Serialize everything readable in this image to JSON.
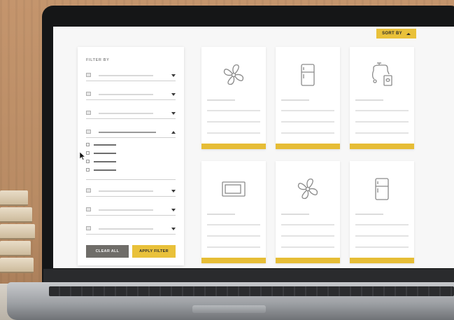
{
  "sort": {
    "label": "SORT BY"
  },
  "filter": {
    "title": "FILTER BY",
    "clear_label": "CLEAR ALL",
    "apply_label": "APPLY FILTER",
    "rows": [
      {
        "state": "collapsed"
      },
      {
        "state": "collapsed"
      },
      {
        "state": "collapsed"
      },
      {
        "state": "expanded",
        "options": 4
      },
      {
        "state": "collapsed"
      },
      {
        "state": "collapsed"
      },
      {
        "state": "collapsed"
      }
    ]
  },
  "products": [
    {
      "icon": "fan-icon"
    },
    {
      "icon": "refrigerator-icon"
    },
    {
      "icon": "faucet-icon"
    },
    {
      "icon": "microwave-icon"
    },
    {
      "icon": "fan-icon"
    },
    {
      "icon": "refrigerator-icon"
    }
  ],
  "colors": {
    "accent": "#e9c13a",
    "clear_button": "#6f6d69"
  }
}
